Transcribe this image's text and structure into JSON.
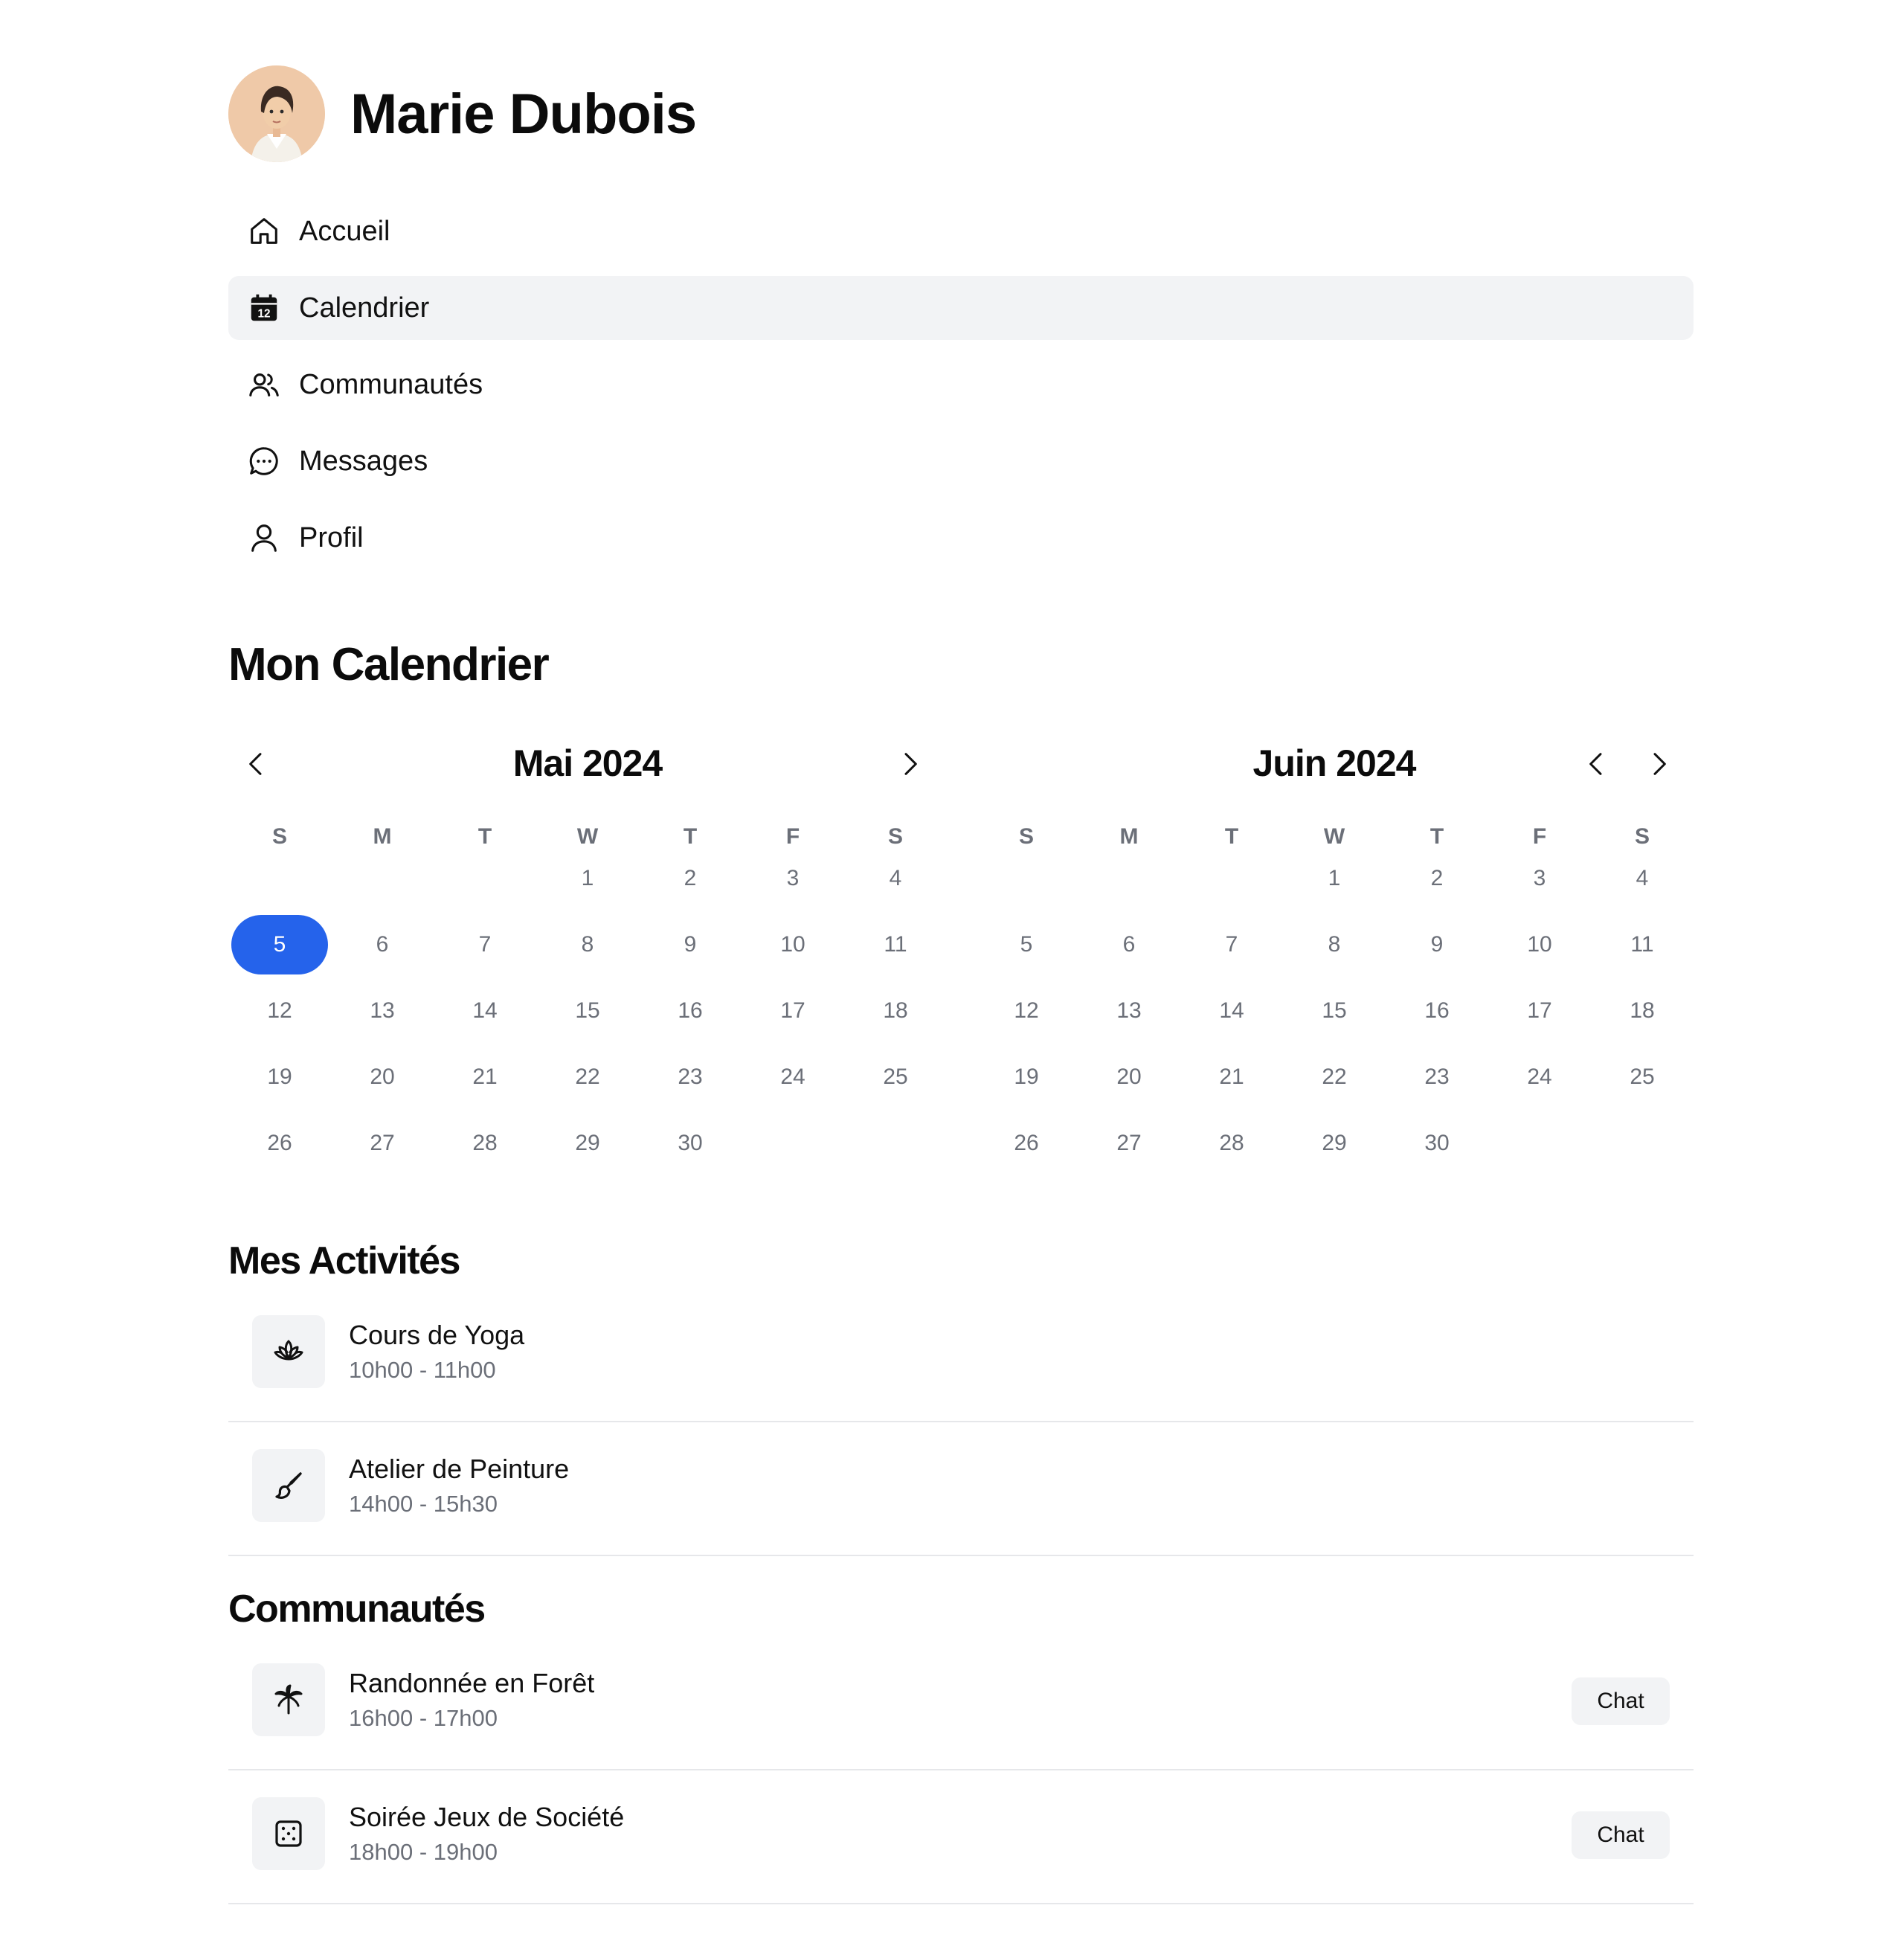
{
  "user": {
    "name": "Marie Dubois"
  },
  "nav": {
    "items": [
      {
        "label": "Accueil",
        "icon": "home-icon"
      },
      {
        "label": "Calendrier",
        "icon": "calendar-icon",
        "badge": "12",
        "active": true
      },
      {
        "label": "Communautés",
        "icon": "users-icon"
      },
      {
        "label": "Messages",
        "icon": "chat-bubble-icon"
      },
      {
        "label": "Profil",
        "icon": "user-icon"
      }
    ]
  },
  "calendar": {
    "title": "Mon Calendrier",
    "weekdays": [
      "S",
      "M",
      "T",
      "W",
      "T",
      "F",
      "S"
    ],
    "months": [
      {
        "label": "Mai 2024",
        "first_weekday": 3,
        "days": 30,
        "selected_day": 5
      },
      {
        "label": "Juin 2024",
        "first_weekday": 3,
        "days": 30,
        "selected_day": null
      }
    ]
  },
  "activities": {
    "title": "Mes Activités",
    "items": [
      {
        "title": "Cours de Yoga",
        "time": "10h00 - 11h00",
        "icon": "lotus-icon"
      },
      {
        "title": "Atelier de Peinture",
        "time": "14h00 - 15h30",
        "icon": "paintbrush-icon"
      }
    ]
  },
  "communities": {
    "title": "Communautés",
    "chat_label": "Chat",
    "items": [
      {
        "title": "Randonnée en Forêt",
        "time": "16h00 - 17h00",
        "icon": "palm-tree-icon"
      },
      {
        "title": "Soirée Jeux de Société",
        "time": "18h00 - 19h00",
        "icon": "dice-icon"
      }
    ]
  },
  "colors": {
    "accent": "#2563eb",
    "muted": "#6b6f78",
    "surface": "#f2f3f5",
    "avatar_bg": "#efc9a8"
  }
}
